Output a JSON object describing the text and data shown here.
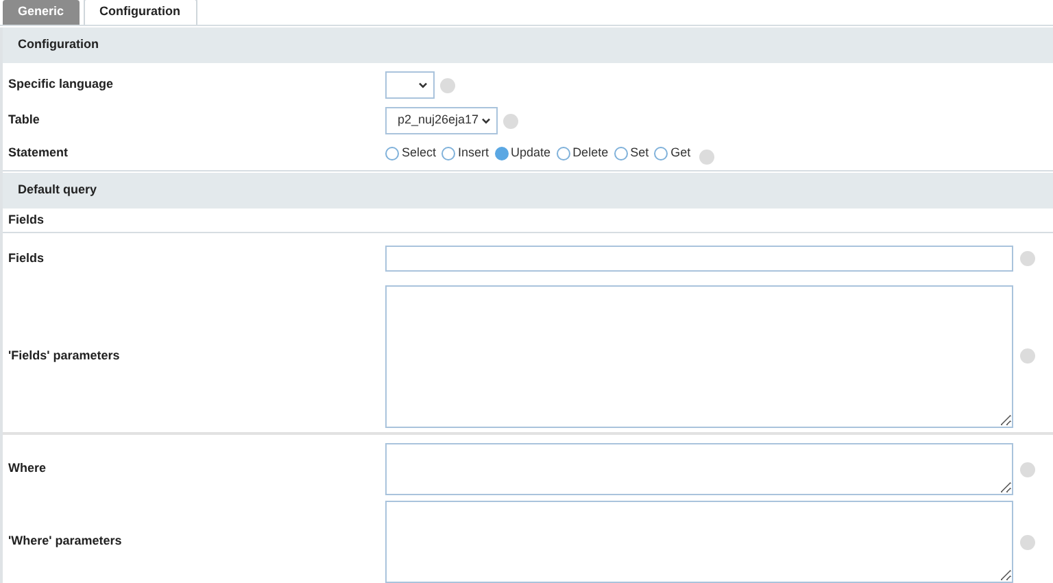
{
  "tabs": [
    {
      "label": "Generic",
      "selected": false
    },
    {
      "label": "Configuration",
      "selected": true
    }
  ],
  "configuration": {
    "title": "Configuration",
    "specific_language": {
      "label": "Specific language"
    },
    "table": {
      "label": "Table",
      "value": "p2_nuj26eja17"
    },
    "statement": {
      "label": "Statement",
      "options": [
        {
          "label": "Select",
          "selected": false
        },
        {
          "label": "Insert",
          "selected": false
        },
        {
          "label": "Update",
          "selected": true
        },
        {
          "label": "Delete",
          "selected": false
        },
        {
          "label": "Set",
          "selected": false
        },
        {
          "label": "Get",
          "selected": false
        }
      ]
    }
  },
  "default_query": {
    "title": "Default query",
    "subtitle": "Fields",
    "groups": [
      [
        {
          "label": "Fields",
          "kind": "input"
        },
        {
          "label": "'Fields' parameters",
          "kind": "textarea"
        }
      ],
      [
        {
          "label": "Where",
          "kind": "textarea_short"
        },
        {
          "label": "'Where' parameters",
          "kind": "textarea"
        }
      ]
    ]
  }
}
